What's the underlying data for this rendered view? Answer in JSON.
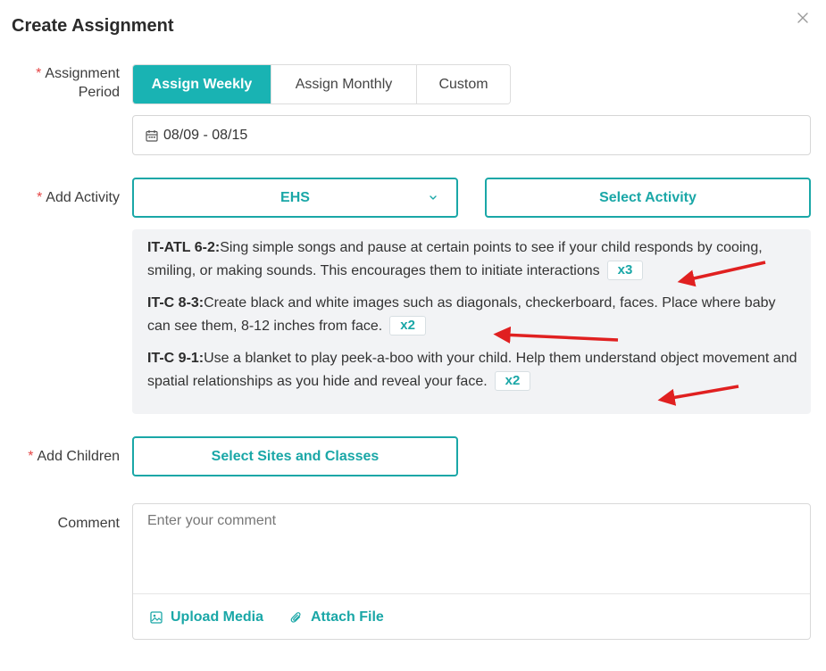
{
  "modal": {
    "title": "Create Assignment"
  },
  "labels": {
    "assignment_period_line1": "Assignment",
    "assignment_period_line2": "Period",
    "add_activity": "Add Activity",
    "add_children": "Add Children",
    "comment": "Comment",
    "required_marker": "*"
  },
  "period_tabs": [
    {
      "label": "Assign Weekly",
      "active": true
    },
    {
      "label": "Assign Monthly",
      "active": false
    },
    {
      "label": "Custom",
      "active": false
    }
  ],
  "date_range": {
    "value": "08/09 - 08/15",
    "icon": "calendar-icon"
  },
  "activity_select": {
    "value": "EHS",
    "icon": "chevron-down-icon"
  },
  "select_activity_button": "Select Activity",
  "activities": [
    {
      "code": "IT-ATL 6-2:",
      "text": "Sing simple songs and pause at certain points to see if your child responds by cooing, smiling, or making sounds. This encourages them to initiate interactions",
      "multiplier": "x3"
    },
    {
      "code": "IT-C 8-3:",
      "text": "Create black and white images such as diagonals, checkerboard, faces. Place where baby can see them, 8-12 inches from face.",
      "multiplier": "x2"
    },
    {
      "code": "IT-C 9-1:",
      "text": "Use a blanket to play peek-a-boo with your child. Help them understand object movement and spatial relationships as you hide and reveal your face.",
      "multiplier": "x2"
    }
  ],
  "select_sites_button": "Select Sites and Classes",
  "comment": {
    "placeholder": "Enter your comment",
    "upload_media": "Upload Media",
    "attach_file": "Attach File"
  },
  "colors": {
    "accent": "#1aa7a7",
    "active_tab": "#19b3b3",
    "required": "#e54545",
    "annotation_arrow": "#e02020"
  }
}
